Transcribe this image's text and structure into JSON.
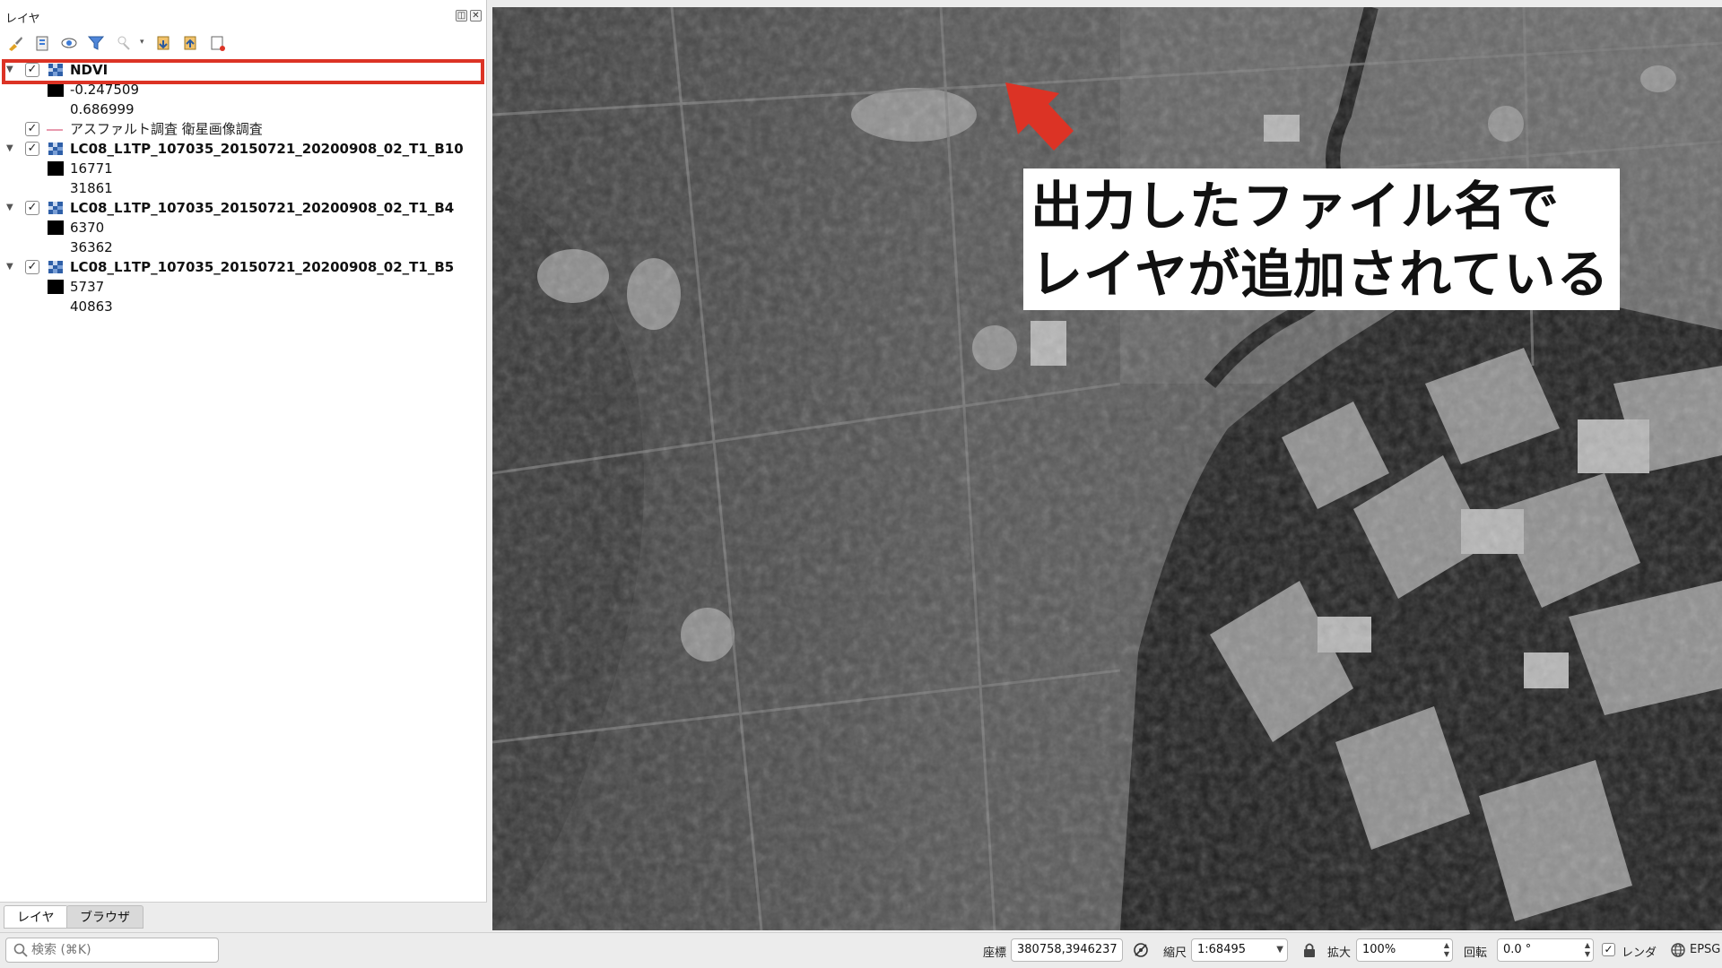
{
  "panel": {
    "title": "レイヤ",
    "float_btn": "◫",
    "close_btn": "✕"
  },
  "layers": [
    {
      "name": "NDVI",
      "checked": true,
      "expanded": true,
      "legend": [
        "-0.247509",
        "0.686999"
      ]
    },
    {
      "name": "アスファルト調査 衛星画像調査",
      "checked": true,
      "type": "vector"
    },
    {
      "name": "LC08_L1TP_107035_20150721_20200908_02_T1_B10",
      "checked": true,
      "expanded": true,
      "legend": [
        "16771",
        "31861"
      ]
    },
    {
      "name": "LC08_L1TP_107035_20150721_20200908_02_T1_B4",
      "checked": true,
      "expanded": true,
      "legend": [
        "6370",
        "36362"
      ]
    },
    {
      "name": "LC08_L1TP_107035_20150721_20200908_02_T1_B5",
      "checked": true,
      "expanded": true,
      "legend": [
        "5737",
        "40863"
      ]
    }
  ],
  "tabs": {
    "layers": "レイヤ",
    "browser": "ブラウザ"
  },
  "search": {
    "placeholder": "検索 (⌘K)"
  },
  "status": {
    "coord_label": "座標",
    "coord_value": "380758,3946237",
    "scale_label": "縮尺",
    "scale_value": "1:68495",
    "magnify_label": "拡大",
    "magnify_value": "100%",
    "rotation_label": "回転",
    "rotation_value": "0.0 °",
    "render_label": "レンダ",
    "crs_label": "EPSG"
  },
  "annotation": {
    "line1": "出力したファイル名で",
    "line2": "レイヤが追加されている",
    "arrow_color": "#dc3325"
  }
}
